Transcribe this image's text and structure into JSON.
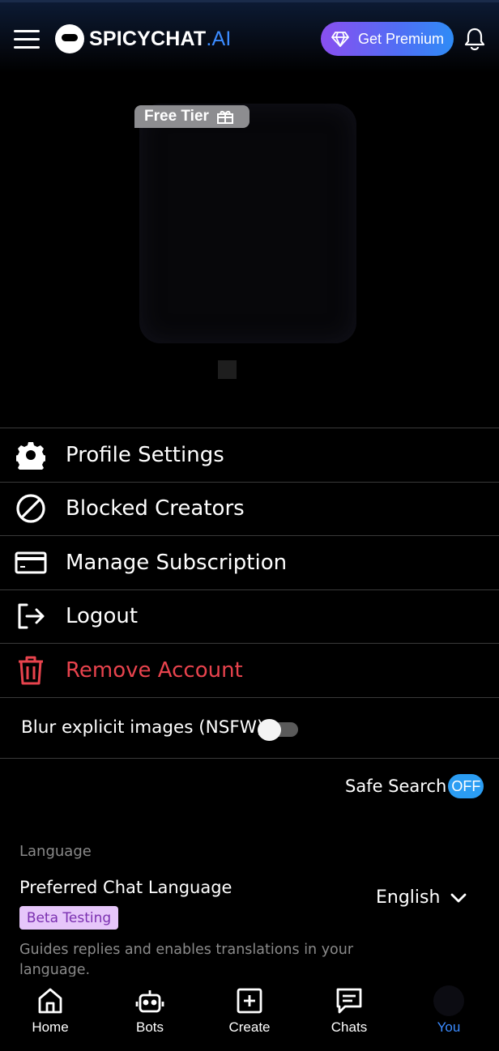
{
  "header": {
    "logo_main": "SPICYCHAT",
    "logo_suffix": ".AI",
    "premium_label": "Get Premium"
  },
  "profile": {
    "tier_badge": "Free Tier"
  },
  "menu": {
    "profile_settings": "Profile Settings",
    "blocked_creators": "Blocked Creators",
    "manage_subscription": "Manage Subscription",
    "logout": "Logout",
    "remove_account": "Remove Account"
  },
  "settings": {
    "blur_nsfw_label": "Blur explicit images (NSFW)",
    "blur_nsfw_enabled": false,
    "safe_search_label": "Safe Search",
    "safe_search_state": "OFF"
  },
  "language": {
    "section_label": "Language",
    "preferred_title": "Preferred Chat Language",
    "beta_badge": "Beta Testing",
    "selected": "English",
    "description": "Guides replies and enables translations in your language."
  },
  "bottom_nav": {
    "home": "Home",
    "bots": "Bots",
    "create": "Create",
    "chats": "Chats",
    "you": "You"
  },
  "colors": {
    "accent": "#3b8bff",
    "danger": "#e8434d",
    "premium_start": "#8a4ff0",
    "premium_end": "#2f8cf6",
    "toggle_on": "#2b9df3",
    "beta_bg": "#e6c6fa"
  }
}
